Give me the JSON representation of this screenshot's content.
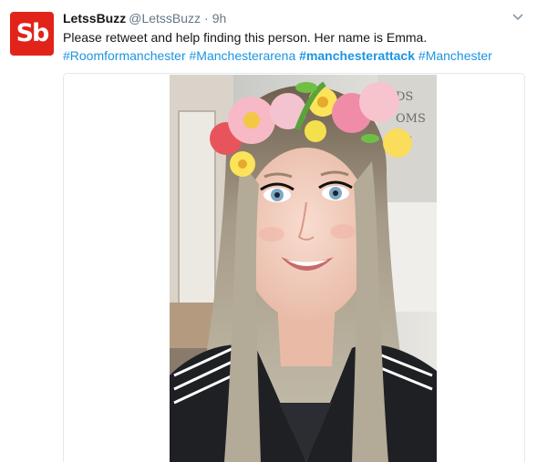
{
  "tweet": {
    "author_name": "LetssBuzz",
    "handle": "@LetssBuzz",
    "separator": "·",
    "time": "9h",
    "avatar_text": "Sb",
    "text": "Please retweet and help finding this person. Her name is Emma.",
    "hashtags": [
      {
        "text": "#Roomformanchester",
        "bold": false
      },
      {
        "text": "#Manchesterarena",
        "bold": false
      },
      {
        "text": "#manchesterattack",
        "bold": true
      },
      {
        "text": "#Manchester",
        "bold": false
      }
    ]
  },
  "icons": {
    "menu": "chevron-down-icon"
  },
  "colors": {
    "brand_red": "#e2231a",
    "link_blue": "#1b95e0",
    "muted_gray": "#657786",
    "text": "#14171a"
  }
}
